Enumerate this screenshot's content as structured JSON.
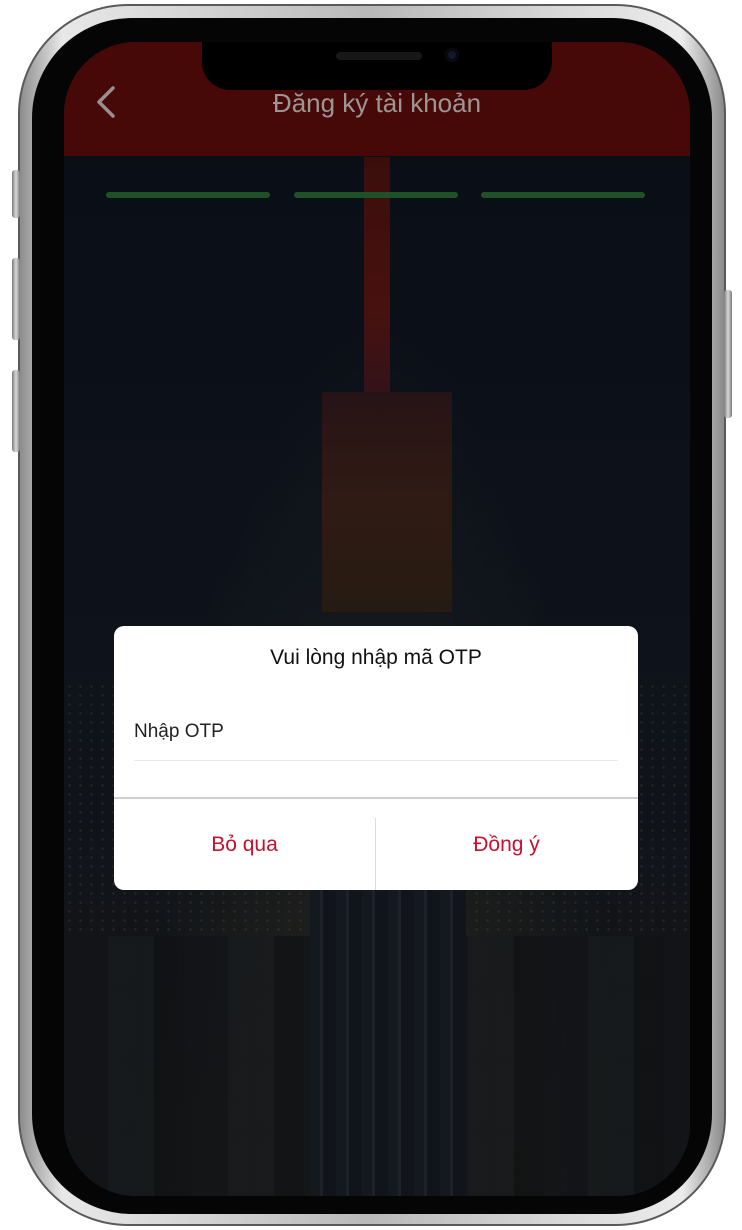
{
  "header": {
    "title": "Đăng ký tài khoản",
    "back_icon": "chevron-left-icon",
    "background_color": "#6e0f0c"
  },
  "progress": {
    "steps": 3,
    "completed": 3,
    "color": "#2e7d3c"
  },
  "dialog": {
    "title": "Vui lòng nhập mã OTP",
    "input": {
      "placeholder": "Nhập OTP",
      "value": ""
    },
    "buttons": {
      "skip_label": "Bỏ qua",
      "agree_label": "Đồng ý"
    },
    "button_color": "#c8102e"
  }
}
